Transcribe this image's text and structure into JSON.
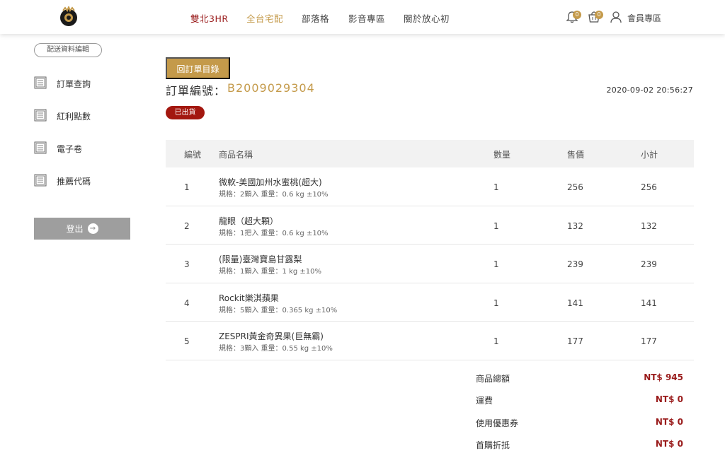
{
  "header": {
    "nav": [
      "雙北3HR",
      "全台宅配",
      "部落格",
      "影音專區",
      "關於放心初"
    ],
    "notification_count": "0",
    "cart_count": "0",
    "member_label": "會員專區"
  },
  "sidebar": {
    "edit_button": "配送資料編輯",
    "items": [
      {
        "label": "訂單查詢"
      },
      {
        "label": "紅利點數"
      },
      {
        "label": "電子卷"
      },
      {
        "label": "推薦代碼"
      }
    ],
    "logout": "登出"
  },
  "order": {
    "back_button": "回訂單目錄",
    "number_label": "訂單編號：",
    "number": "B2009029304",
    "datetime": "2020-09-02 20:56:27",
    "status": "已出貨"
  },
  "table": {
    "headers": {
      "no": "編號",
      "name": "商品名稱",
      "qty": "數量",
      "price": "售價",
      "subtotal": "小計"
    },
    "rows": [
      {
        "no": "1",
        "name": "微軟-美國加州水蜜桃(超大)",
        "spec": "規格：2顆入 重量：0.6 kg ±10%",
        "qty": "1",
        "price": "256",
        "subtotal": "256"
      },
      {
        "no": "2",
        "name": "龍眼（超大顆）",
        "spec": "規格：1把入 重量：0.6 kg ±10%",
        "qty": "1",
        "price": "132",
        "subtotal": "132"
      },
      {
        "no": "3",
        "name": "(限量)臺灣寶島甘露梨",
        "spec": "規格：1顆入 重量：1 kg ±10%",
        "qty": "1",
        "price": "239",
        "subtotal": "239"
      },
      {
        "no": "4",
        "name": "Rockit樂淇蘋果",
        "spec": "規格：5顆入 重量：0.365 kg ±10%",
        "qty": "1",
        "price": "141",
        "subtotal": "141"
      },
      {
        "no": "5",
        "name": "ZESPRI黃金奇異果(巨無霸)",
        "spec": "規格：3顆入 重量：0.55 kg ±10%",
        "qty": "1",
        "price": "177",
        "subtotal": "177"
      }
    ]
  },
  "summary": [
    {
      "label": "商品總額",
      "value": "NT$ 945"
    },
    {
      "label": "運費",
      "value": "NT$ 0"
    },
    {
      "label": "使用優惠券",
      "value": "NT$ 0"
    },
    {
      "label": "首購折抵",
      "value": "NT$ 0"
    }
  ],
  "colors": {
    "accent": "#c49a4a",
    "brand_red": "#9a1c1c",
    "status_red": "#a3170f"
  }
}
